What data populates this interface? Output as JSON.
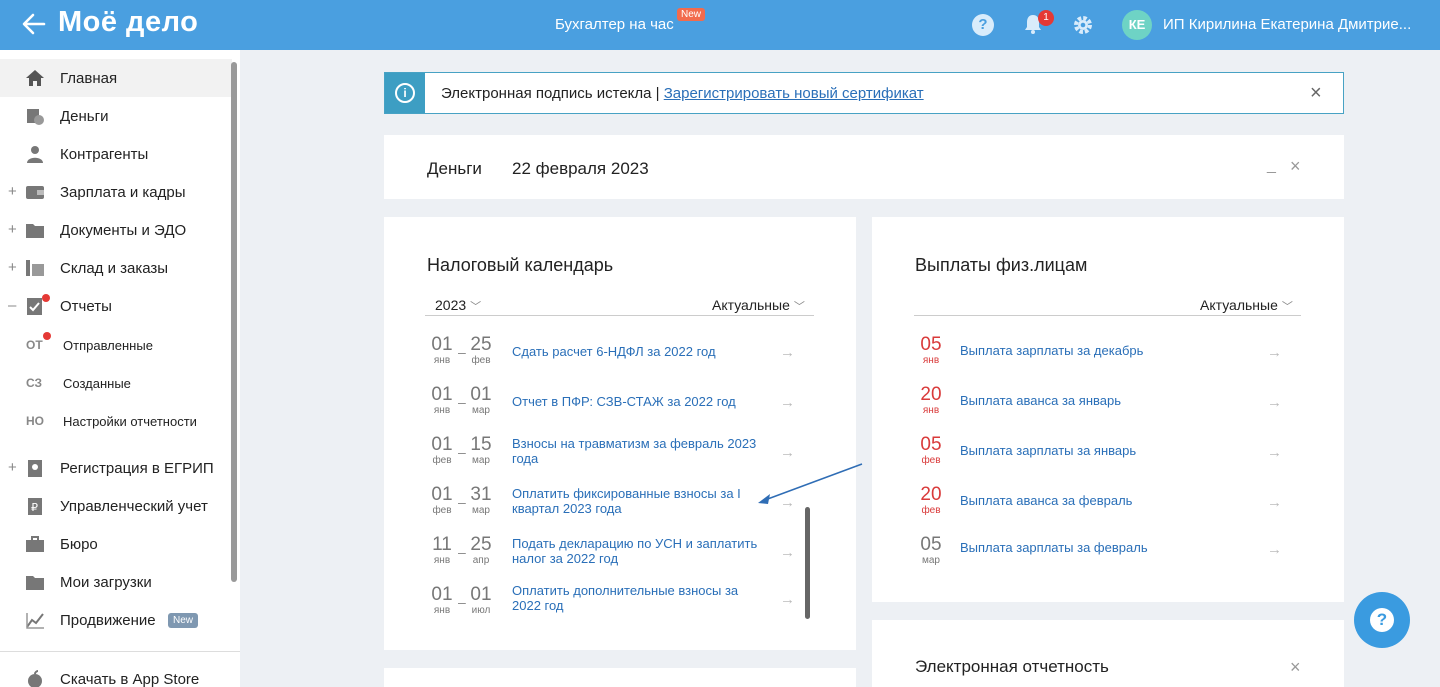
{
  "header": {
    "logo": "Моё дело",
    "center_title": "Бухгалтер на час",
    "center_badge": "New",
    "help": "?",
    "notifications_count": "1",
    "avatar_initials": "КЕ",
    "user_name": "ИП Кирилина Екатерина Дмитрие..."
  },
  "sidebar": {
    "items": [
      {
        "label": "Главная",
        "icon": "home-icon"
      },
      {
        "label": "Деньги",
        "icon": "money-icon"
      },
      {
        "label": "Контрагенты",
        "icon": "contractor-icon"
      },
      {
        "label": "Зарплата и кадры",
        "icon": "wallet-icon"
      },
      {
        "label": "Документы и ЭДО",
        "icon": "folder-icon"
      },
      {
        "label": "Склад и заказы",
        "icon": "warehouse-icon"
      },
      {
        "label": "Отчеты",
        "icon": "report-icon"
      },
      {
        "label": "Регистрация в ЕГРИП",
        "icon": "registration-icon"
      },
      {
        "label": "Управленческий учет",
        "icon": "ruble-doc-icon"
      },
      {
        "label": "Бюро",
        "icon": "briefcase-icon"
      },
      {
        "label": "Мои загрузки",
        "icon": "folder-icon"
      },
      {
        "label": "Продвижение",
        "icon": "chart-icon"
      },
      {
        "label": "Скачать в App Store",
        "icon": "apple-icon"
      }
    ],
    "subitems": [
      {
        "abbr": "ОТ",
        "label": "Отправленные"
      },
      {
        "abbr": "СЗ",
        "label": "Созданные"
      },
      {
        "abbr": "НО",
        "label": "Настройки отчетности"
      }
    ],
    "plus": "+",
    "minus": "–",
    "new_badge": "New"
  },
  "alert": {
    "text": "Электронная подпись истекла | ",
    "link": "Зарегистрировать новый сертификат",
    "close": "×"
  },
  "money": {
    "title": "Деньги",
    "date": "22 февраля 2023",
    "minimize": "_",
    "close": "×"
  },
  "tax_calendar": {
    "title": "Налоговый календарь",
    "year": "2023",
    "filter": "Актуальные",
    "rows": [
      {
        "d1": "01",
        "m1": "янв",
        "d2": "25",
        "m2": "фев",
        "text": "Сдать расчет 6-НДФЛ за 2022 год"
      },
      {
        "d1": "01",
        "m1": "янв",
        "d2": "01",
        "m2": "мар",
        "text": "Отчет в ПФР: СЗВ-СТАЖ за 2022 год"
      },
      {
        "d1": "01",
        "m1": "фев",
        "d2": "15",
        "m2": "мар",
        "text": "Взносы на травматизм за февраль 2023 года"
      },
      {
        "d1": "01",
        "m1": "фев",
        "d2": "31",
        "m2": "мар",
        "text": "Оплатить фиксированные взносы за I квартал 2023 года"
      },
      {
        "d1": "11",
        "m1": "янв",
        "d2": "25",
        "m2": "апр",
        "text": "Подать декларацию по УСН и заплатить налог за 2022 год"
      },
      {
        "d1": "01",
        "m1": "янв",
        "d2": "01",
        "m2": "июл",
        "text": "Оплатить дополнительные взносы за 2022 год"
      }
    ],
    "dash": "–",
    "arrow": "→"
  },
  "payments": {
    "title": "Выплаты физ.лицам",
    "filter": "Актуальные",
    "rows": [
      {
        "day": "05",
        "mon": "янв",
        "text": "Выплата зарплаты за декабрь",
        "overdue": true
      },
      {
        "day": "20",
        "mon": "янв",
        "text": "Выплата аванса за январь",
        "overdue": true
      },
      {
        "day": "05",
        "mon": "фев",
        "text": "Выплата зарплаты за январь",
        "overdue": true
      },
      {
        "day": "20",
        "mon": "фев",
        "text": "Выплата аванса за февраль",
        "overdue": true
      },
      {
        "day": "05",
        "mon": "мар",
        "text": "Выплата зарплаты за февраль",
        "overdue": false
      }
    ],
    "arrow": "→"
  },
  "e_reporting": {
    "title": "Электронная отчетность",
    "close": "×"
  },
  "colors": {
    "topbar": "#4a9fe0",
    "link": "#2a6fb8",
    "overdue": "#d93a3a",
    "muted_date": "#777777",
    "alert_border": "#47a2c4"
  }
}
